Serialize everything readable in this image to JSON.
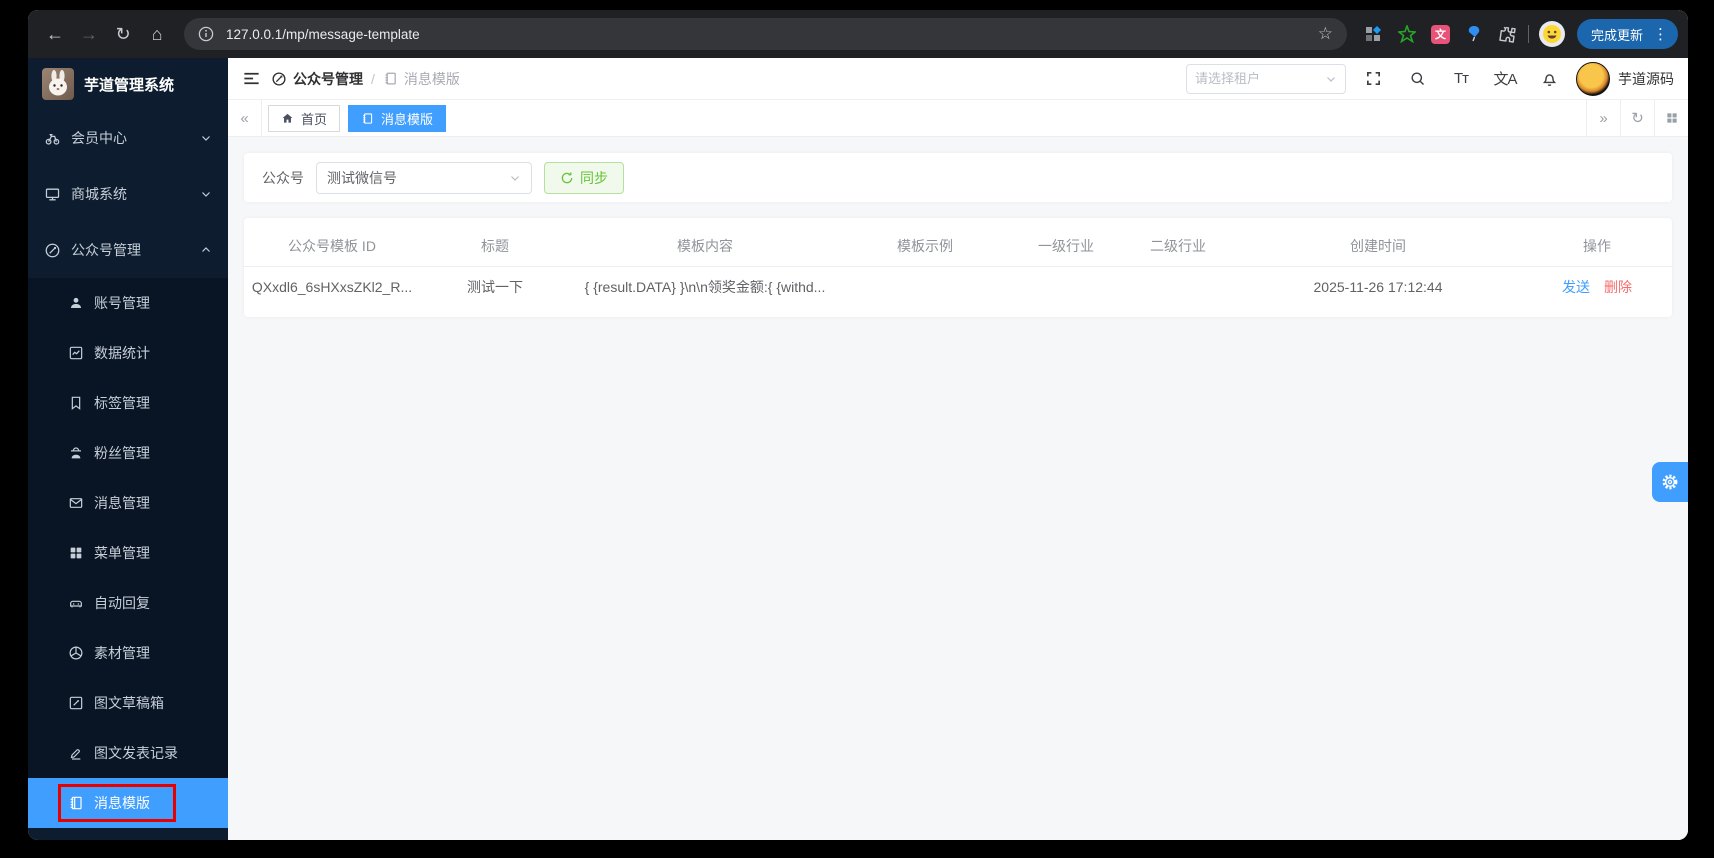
{
  "browser": {
    "url": "127.0.0.1/mp/message-template",
    "update_button": "完成更新"
  },
  "icons": {
    "back": "←",
    "forward": "→",
    "reload": "↻",
    "home": "⌂",
    "star": "☆",
    "kebab": "⋮",
    "collapse_tabs": "«",
    "expand_tabs": "»",
    "tab_refresh": "↻",
    "font_size": "Tт",
    "language": "文A",
    "translate_ext": "文"
  },
  "sidebar": {
    "app_title": "芋道管理系统",
    "menu": [
      {
        "label": "会员中心"
      },
      {
        "label": "商城系统"
      },
      {
        "label": "公众号管理"
      }
    ],
    "submenu": [
      {
        "label": "账号管理"
      },
      {
        "label": "数据统计"
      },
      {
        "label": "标签管理"
      },
      {
        "label": "粉丝管理"
      },
      {
        "label": "消息管理"
      },
      {
        "label": "菜单管理"
      },
      {
        "label": "自动回复"
      },
      {
        "label": "素材管理"
      },
      {
        "label": "图文草稿箱"
      },
      {
        "label": "图文发表记录"
      },
      {
        "label": "消息模版"
      }
    ],
    "active_item": "消息模版"
  },
  "header": {
    "breadcrumb_parent": "公众号管理",
    "breadcrumb_separator": "/",
    "breadcrumb_current": "消息模版",
    "tenant_placeholder": "请选择租户",
    "username": "芋道源码"
  },
  "tabs": [
    {
      "label": "首页"
    },
    {
      "label": "消息模版"
    }
  ],
  "filter": {
    "account_label": "公众号",
    "account_value": "测试微信号",
    "sync_label": "同步"
  },
  "table": {
    "columns": [
      "公众号模板 ID",
      "标题",
      "模板内容",
      "模板示例",
      "一级行业",
      "二级行业",
      "创建时间",
      "操作"
    ],
    "row": {
      "template_id": "QXxdl6_6sHXxsZKl2_R...",
      "title": "测试一下",
      "content": "{ {result.DATA} }\\n\\n领奖金额:{ {withd...",
      "example": "",
      "industry_level1": "",
      "industry_level2": "",
      "create_time": "2025-11-26 17:12:44",
      "send_label": "发送",
      "delete_label": "删除"
    }
  },
  "colors": {
    "accent_blue": "#409eff",
    "success_green": "#67c23a",
    "danger_red": "#f56c6c",
    "sidebar_bg": "#0d1c2e",
    "annotation_red": "#e60000",
    "chrome_bg": "#202124"
  }
}
